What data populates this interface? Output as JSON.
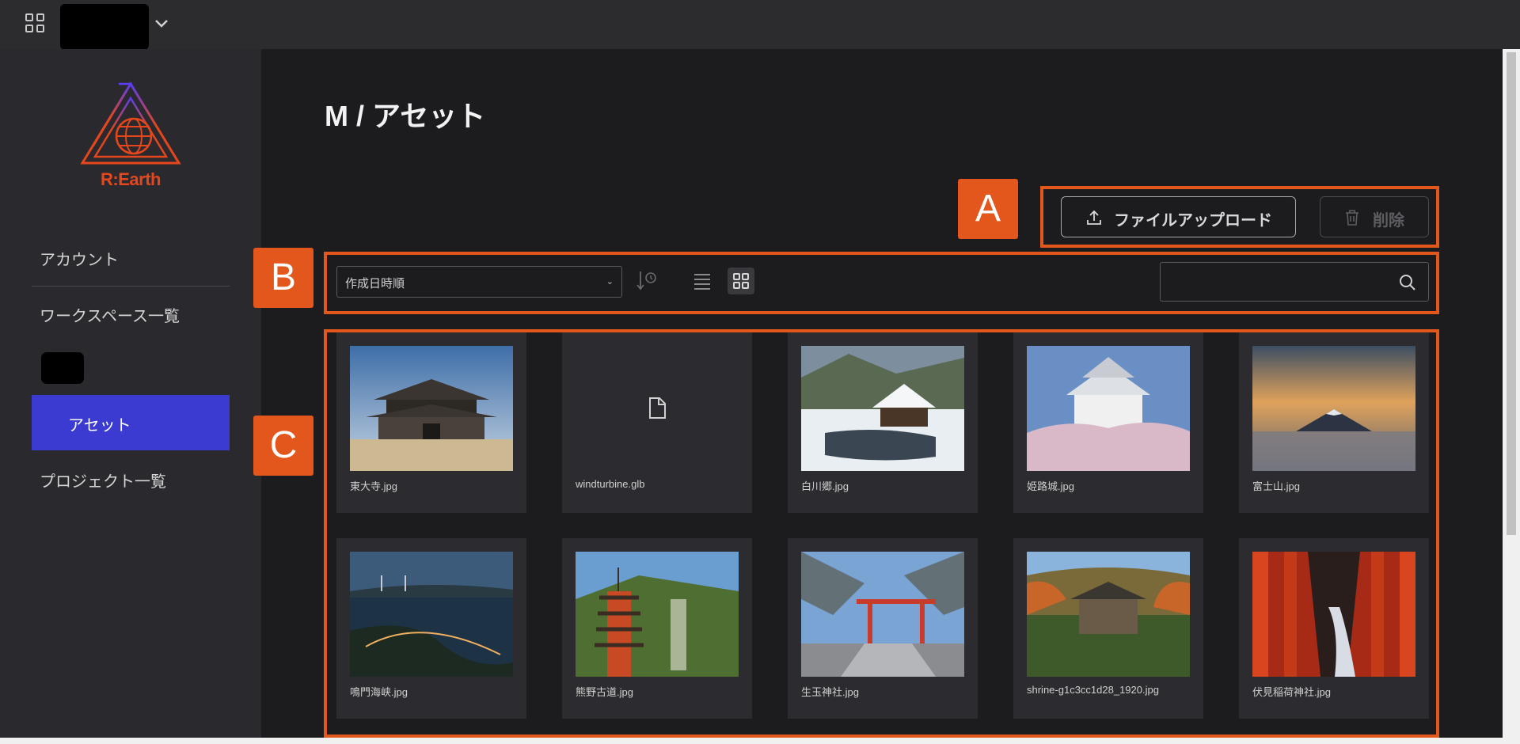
{
  "sidebar": {
    "logo_text": "R:Earth",
    "account": "アカウント",
    "workspace_list": "ワークスペース一覧",
    "assets": "アセット",
    "project_list": "プロジェクト一覧"
  },
  "main": {
    "title": "M / アセット",
    "upload_label": "ファイルアップロード",
    "delete_label": "削除",
    "sort_label": "作成日時順",
    "search_placeholder": ""
  },
  "markers": {
    "a": "A",
    "b": "B",
    "c": "C"
  },
  "assets": [
    {
      "name": "東大寺.jpg",
      "type": "image"
    },
    {
      "name": "windturbine.glb",
      "type": "file"
    },
    {
      "name": "白川郷.jpg",
      "type": "image"
    },
    {
      "name": "姫路城.jpg",
      "type": "image"
    },
    {
      "name": "富士山.jpg",
      "type": "image"
    },
    {
      "name": "鳴門海峡.jpg",
      "type": "image"
    },
    {
      "name": "熊野古道.jpg",
      "type": "image"
    },
    {
      "name": "生玉神社.jpg",
      "type": "image"
    },
    {
      "name": "shrine-g1c3cc1d28_1920.jpg",
      "type": "image"
    },
    {
      "name": "伏見稲荷神社.jpg",
      "type": "image"
    }
  ],
  "colors": {
    "accent": "#3b3bd1",
    "annotation": "#e3571c",
    "logo": "#e5461c"
  }
}
